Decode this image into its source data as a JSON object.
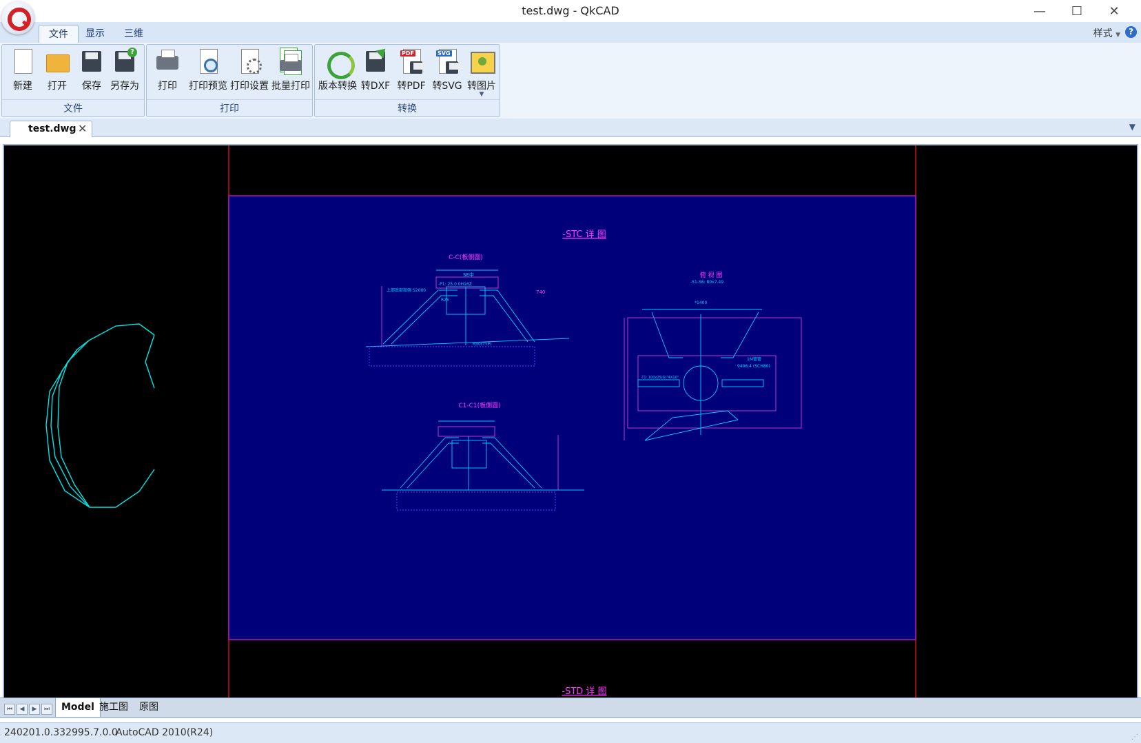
{
  "window": {
    "title": "test.dwg - QkCAD",
    "minimize_glyph": "—",
    "maximize_glyph": "☐",
    "close_glyph": "✕"
  },
  "menubar": {
    "tabs": [
      {
        "label": "文件"
      },
      {
        "label": "显示"
      },
      {
        "label": "三维"
      }
    ],
    "style_label": "样式",
    "help_glyph": "?"
  },
  "ribbon": {
    "groups": [
      {
        "label": "文件",
        "buttons": [
          {
            "label": "新建",
            "icon": "new-file-icon"
          },
          {
            "label": "打开",
            "icon": "open-folder-icon"
          },
          {
            "label": "保存",
            "icon": "save-icon"
          },
          {
            "label": "另存为",
            "icon": "save-as-icon"
          }
        ]
      },
      {
        "label": "打印",
        "buttons": [
          {
            "label": "打印",
            "icon": "print-icon"
          },
          {
            "label": "打印预览",
            "icon": "print-preview-icon"
          },
          {
            "label": "打印设置",
            "icon": "print-settings-icon"
          },
          {
            "label": "批量打印",
            "icon": "batch-print-icon"
          }
        ]
      },
      {
        "label": "转换",
        "buttons": [
          {
            "label": "版本转换",
            "icon": "version-convert-icon"
          },
          {
            "label": "转DXF",
            "icon": "to-dxf-icon"
          },
          {
            "label": "转PDF",
            "icon": "to-pdf-icon"
          },
          {
            "label": "转SVG",
            "icon": "to-svg-icon"
          },
          {
            "label": "转图片",
            "icon": "to-image-icon"
          }
        ]
      }
    ],
    "badges": {
      "pdf": "PDF",
      "svg": "SVG"
    }
  },
  "document_tab": {
    "label": "test.dwg",
    "close_glyph": "✕",
    "dropdown_glyph": "▼"
  },
  "drawing": {
    "background": "#000000",
    "sheet_color": "#00007a",
    "title_top": "-STC 详 图",
    "title_bottom": "-STD 详 图",
    "view_c": "C-C(板側圖)",
    "view_c1": "C1-C1(板側圖)",
    "view_plan": "俯 视 图",
    "ann": [
      "-P1: 25.0 0H16Z",
      "上部底部加强 S2080",
      "SE中",
      "740",
      "R25",
      "R50(TYP)",
      "*1400",
      "-S1-S6: 80x7.49",
      "-T1: 100x25(G)\"4X10\"",
      "9406.4 (SCH80)",
      "1M管管"
    ]
  },
  "sheets": {
    "tabs": [
      "Model",
      "施工图",
      "原图"
    ],
    "nav": [
      "⏮",
      "◀",
      "▶",
      "⏭"
    ]
  },
  "status": {
    "version": "240201.0.332995.7.0.0",
    "format": "AutoCAD 2010(R24)",
    "grip_glyph": "⋰"
  }
}
